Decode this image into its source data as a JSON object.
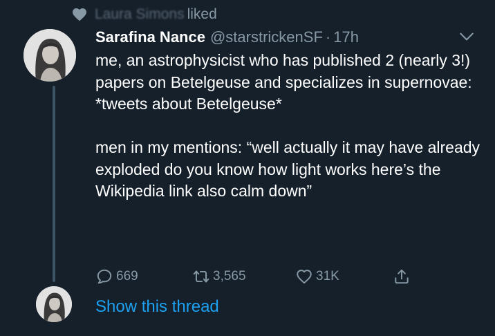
{
  "social_context": {
    "liker": "Laura Simons",
    "action": "liked",
    "icon": "heart-icon"
  },
  "tweet": {
    "author": {
      "display_name": "Sarafina Nance",
      "handle": "@starstrickenSF",
      "separator": "·",
      "time": "17h"
    },
    "text": {
      "paragraph_1": "me, an astrophysicist who has published 2 (nearly 3!) papers on Betelgeuse and specializes in supernovae: *tweets about Betelgeuse*",
      "paragraph_2": "men in my mentions: “well actually it may have already exploded do you know how light works here’s the Wikipedia link also calm down”"
    },
    "actions": {
      "replies": "669",
      "retweets": "3,565",
      "likes": "31K"
    }
  },
  "show_thread": "Show this thread",
  "colors": {
    "background": "#15202b",
    "secondary_text": "#8899a6",
    "link": "#1da1f2",
    "thread_line": "#3d5466"
  }
}
